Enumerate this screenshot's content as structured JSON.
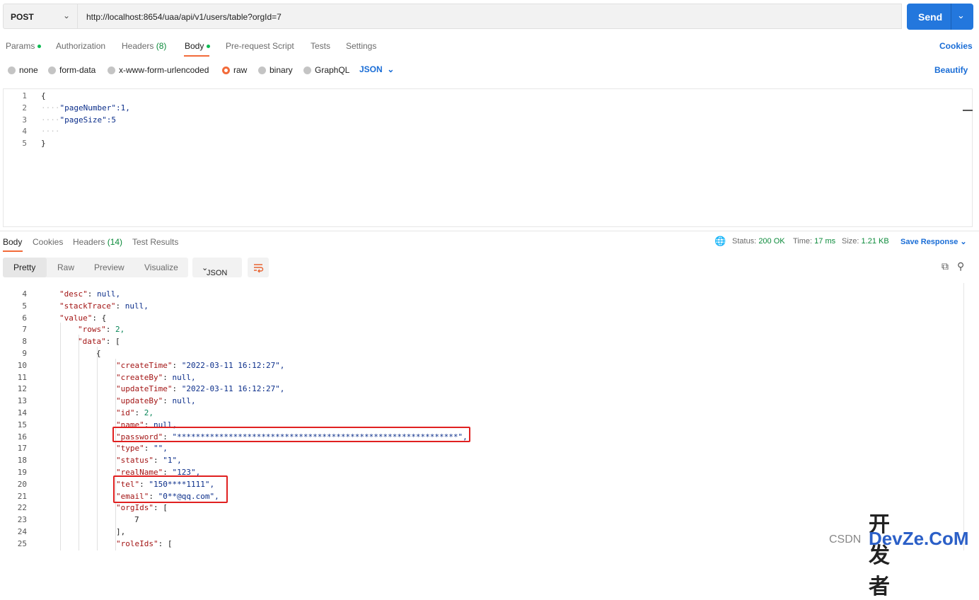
{
  "request": {
    "method": "POST",
    "url": "http://localhost:8654/uaa/api/v1/users/table?orgId=7",
    "send_label": "Send"
  },
  "req_tabs": [
    {
      "label": "Params",
      "dot": true
    },
    {
      "label": "Authorization"
    },
    {
      "label": "Headers",
      "count": "(8)"
    },
    {
      "label": "Body",
      "dot": true,
      "active": true
    },
    {
      "label": "Pre-request Script"
    },
    {
      "label": "Tests"
    },
    {
      "label": "Settings"
    }
  ],
  "cookies_label": "Cookies",
  "body_types": [
    "none",
    "form-data",
    "x-www-form-urlencoded",
    "raw",
    "binary",
    "GraphQL"
  ],
  "body_type_selected": "raw",
  "body_lang": "JSON",
  "beautify_label": "Beautify",
  "editor": {
    "line_numbers": [
      "1",
      "2",
      "3",
      "4",
      "5"
    ],
    "lines": [
      "{",
      "\"pageNumber\":1,",
      "\"pageSize\":5",
      "",
      "}"
    ]
  },
  "resp_tabs": [
    {
      "label": "Body",
      "active": true
    },
    {
      "label": "Cookies"
    },
    {
      "label": "Headers",
      "count": "(14)"
    },
    {
      "label": "Test Results"
    }
  ],
  "status": {
    "status_label": "Status:",
    "status_value": "200 OK",
    "time_label": "Time:",
    "time_value": "17 ms",
    "size_label": "Size:",
    "size_value": "1.21 KB"
  },
  "save_response_label": "Save Response",
  "view_modes": [
    "Pretty",
    "Raw",
    "Preview",
    "Visualize"
  ],
  "resp_format": "JSON",
  "response_lines": [
    {
      "n": "4",
      "t": "\"desc\": null,"
    },
    {
      "n": "5",
      "t": "\"stackTrace\": null,"
    },
    {
      "n": "6",
      "t": "\"value\": {"
    },
    {
      "n": "7",
      "t": "\"rows\": 2,"
    },
    {
      "n": "8",
      "t": "\"data\": ["
    },
    {
      "n": "9",
      "t": "{"
    },
    {
      "n": "10",
      "t": "\"createTime\": \"2022-03-11 16:12:27\","
    },
    {
      "n": "11",
      "t": "\"createBy\": null,"
    },
    {
      "n": "12",
      "t": "\"updateTime\": \"2022-03-11 16:12:27\","
    },
    {
      "n": "13",
      "t": "\"updateBy\": null,"
    },
    {
      "n": "14",
      "t": "\"id\": 2,"
    },
    {
      "n": "15",
      "t": "\"name\": null,"
    },
    {
      "n": "16",
      "t": "\"password\": \"************************************************************\","
    },
    {
      "n": "17",
      "t": "\"type\": \"\","
    },
    {
      "n": "18",
      "t": "\"status\": \"1\","
    },
    {
      "n": "19",
      "t": "\"realName\": \"123\","
    },
    {
      "n": "20",
      "t": "\"tel\": \"150****1111\","
    },
    {
      "n": "21",
      "t": "\"email\": \"0**@qq.com\","
    },
    {
      "n": "22",
      "t": "\"orgIds\": ["
    },
    {
      "n": "23",
      "t": "7"
    },
    {
      "n": "24",
      "t": "],"
    },
    {
      "n": "25",
      "t": "\"roleIds\": ["
    }
  ],
  "watermark": {
    "cn": "开发者",
    "en": "DevZe.CoM",
    "csdn": "CSDN"
  },
  "colors": {
    "send": "#2377dd",
    "accent": "#f26b3a",
    "status_green": "#0b8a3a",
    "highlight_red": "#e02020"
  }
}
